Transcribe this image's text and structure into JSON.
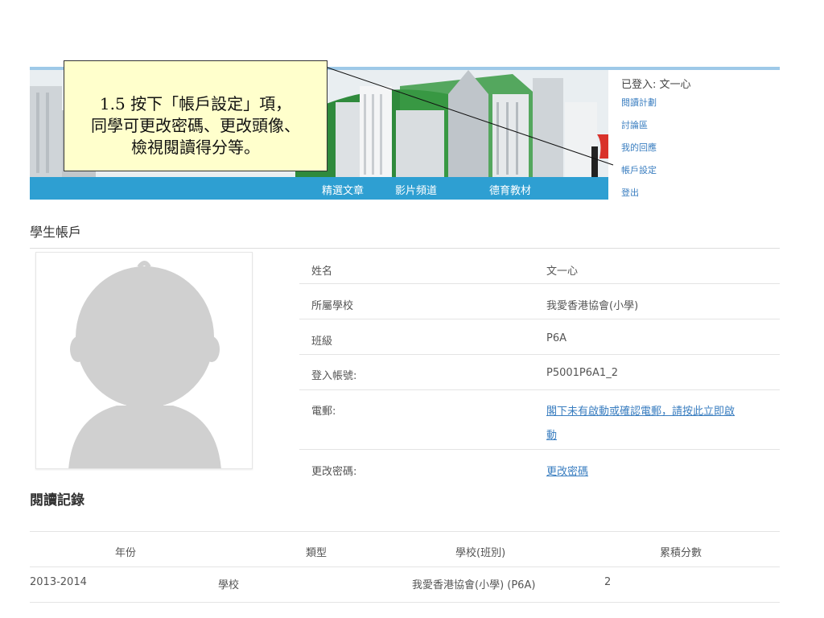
{
  "header": {
    "nav": [
      "精選文章",
      "影片頻道",
      "德育教材"
    ],
    "user": {
      "logged_in": "已登入: 文一心",
      "links": [
        "閱讀計劃",
        "討論區",
        "我的回應",
        "帳戶設定",
        "登出"
      ]
    }
  },
  "callout": {
    "lines": [
      "1.5 按下「帳戶設定」項，",
      "同學可更改密碼、更改頭像、",
      "檢視閱讀得分等。"
    ]
  },
  "account": {
    "title": "學生帳戶",
    "rows": [
      {
        "label": "姓名",
        "value": "文一心"
      },
      {
        "label": "所屬學校",
        "value": "我愛香港協會(小學)"
      },
      {
        "label": "班級",
        "value": "P6A"
      },
      {
        "label": "登入帳號:",
        "value": "P5001P6A1_2"
      },
      {
        "label": "電郵:",
        "value_line1": "閣下未有啟動或確認電郵，請按此立即啟",
        "value_line2": "動"
      },
      {
        "label": "更改密碼:",
        "value": "更改密碼"
      }
    ]
  },
  "reading": {
    "title": "閱讀記錄",
    "headers": [
      "年份",
      "類型",
      "學校(班別)",
      "累積分數"
    ],
    "rows": [
      [
        "2013-2014",
        "學校",
        "我愛香港協會(小學) (P6A)",
        "2"
      ]
    ]
  },
  "colors": {
    "nav_bar": "#2e9fd2",
    "link": "#3a7ec0",
    "callout_bg": "#ffffcc"
  }
}
